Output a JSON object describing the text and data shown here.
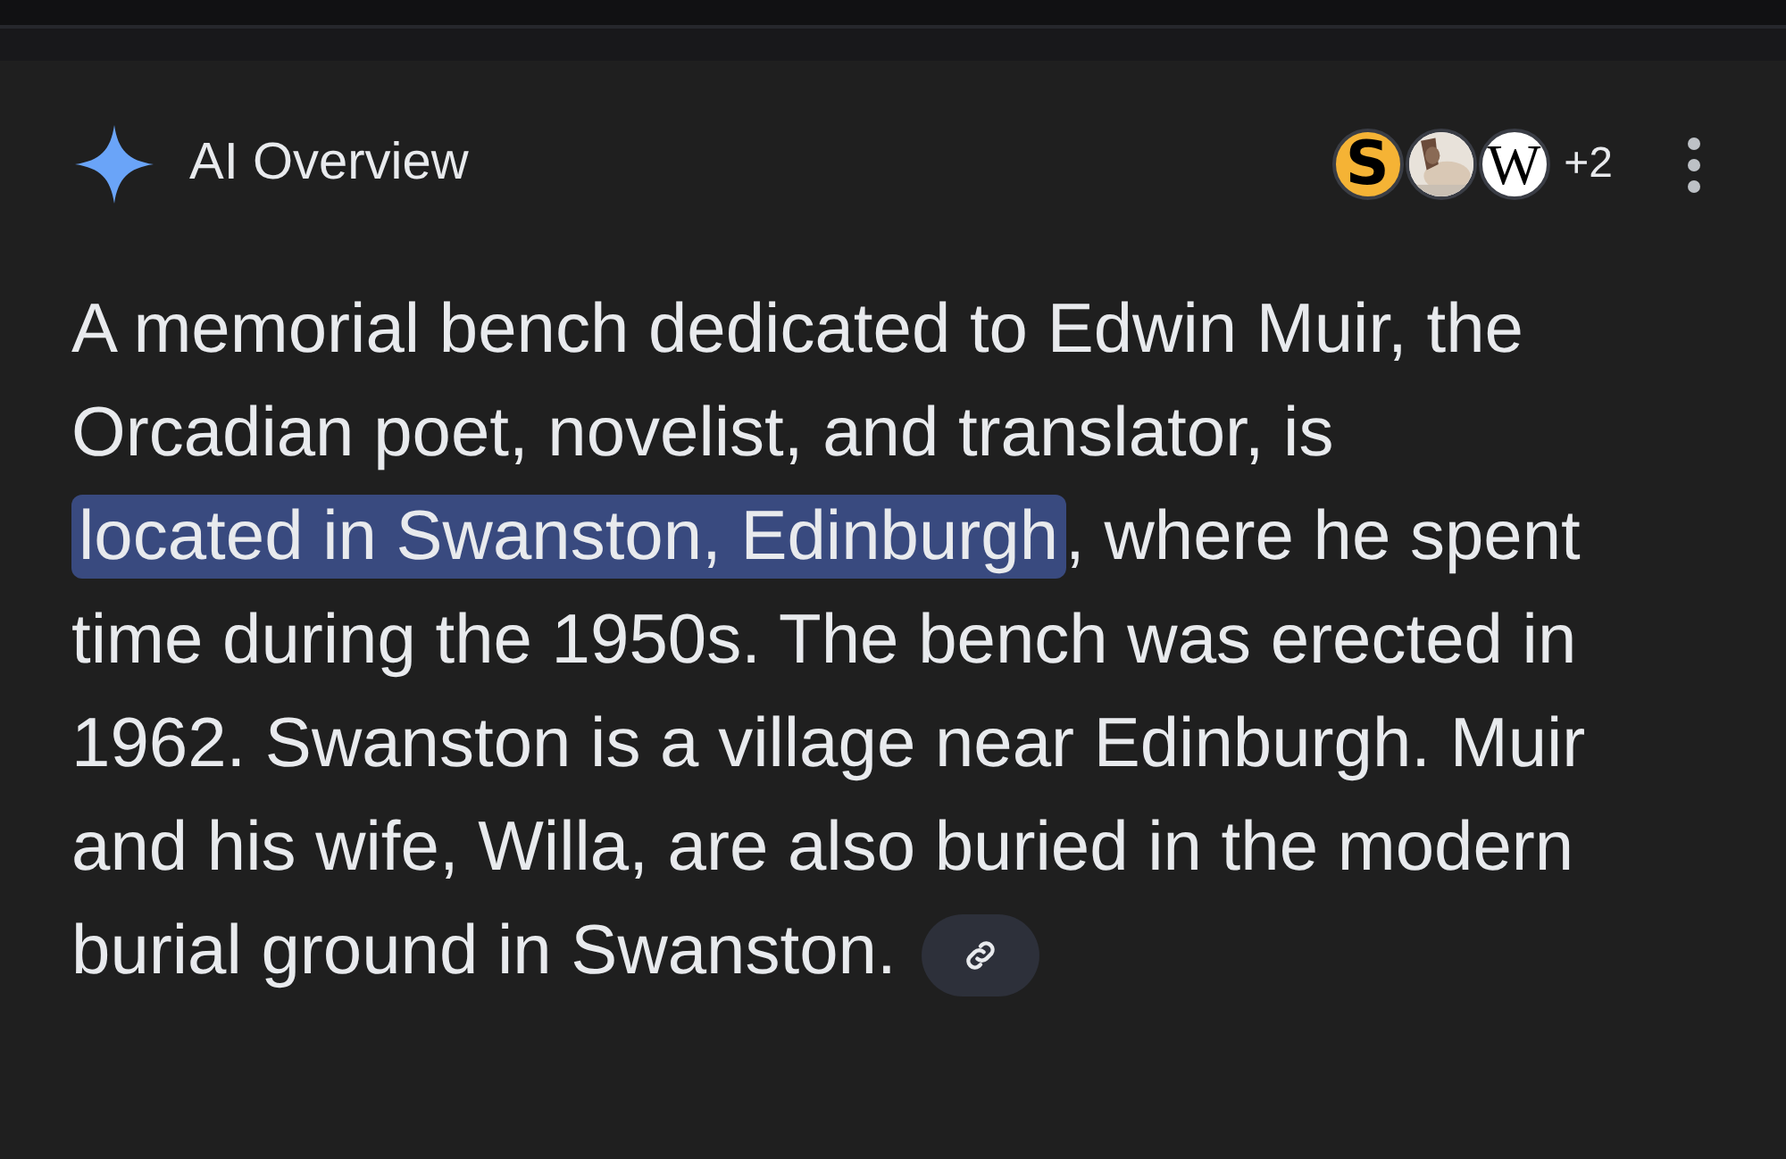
{
  "header": {
    "title": "AI Overview",
    "sources": [
      {
        "kind": "letter",
        "label": "S"
      },
      {
        "kind": "picture"
      },
      {
        "kind": "letter",
        "label": "W"
      }
    ],
    "more_count": "+2"
  },
  "answer": {
    "before": "A memorial bench dedicated to Edwin Muir, the Orcadian poet, novelist, and translator, is ",
    "highlight": "located in Swanston, Edinburgh",
    "after": ", where he spent time during the 1950s. The bench was erected in 1962. Swanston is a village near Edinburgh. Muir and his wife, Willa, are also buried in the modern burial ground in Swanston."
  }
}
